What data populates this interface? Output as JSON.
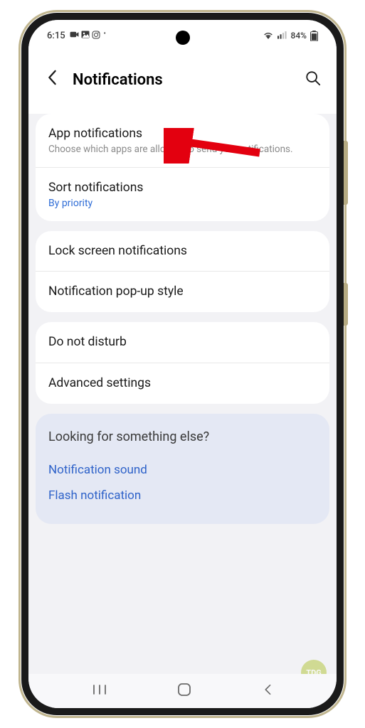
{
  "status_bar": {
    "time": "6:15",
    "battery_text": "84%"
  },
  "header": {
    "title": "Notifications"
  },
  "groups": [
    {
      "rows": [
        {
          "title": "App notifications",
          "subtitle": "Choose which apps are allowed to send you notifications."
        },
        {
          "title": "Sort notifications",
          "subtitle": "By priority",
          "subtitle_class": "link"
        }
      ]
    },
    {
      "rows": [
        {
          "title": "Lock screen notifications"
        },
        {
          "title": "Notification pop-up style"
        }
      ]
    },
    {
      "rows": [
        {
          "title": "Do not disturb"
        },
        {
          "title": "Advanced settings"
        }
      ]
    }
  ],
  "extra": {
    "title": "Looking for something else?",
    "links": [
      "Notification sound",
      "Flash notification"
    ]
  },
  "watermark": "TDG"
}
